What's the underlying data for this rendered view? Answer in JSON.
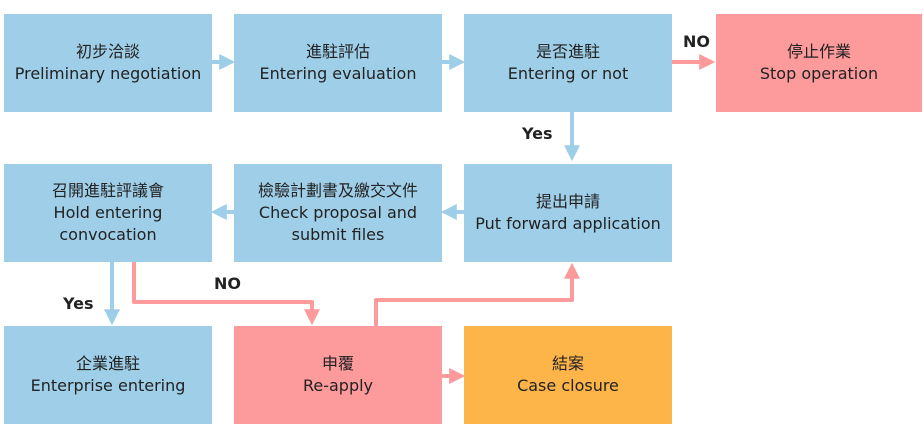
{
  "diagram": {
    "nodes": {
      "n1": {
        "zh": "初步洽談",
        "en": "Preliminary negotiation"
      },
      "n2": {
        "zh": "進駐評估",
        "en": "Entering evaluation"
      },
      "n3": {
        "zh": "是否進駐",
        "en": "Entering or not"
      },
      "n4": {
        "zh": "停止作業",
        "en": "Stop operation"
      },
      "n5": {
        "zh": "提出申請",
        "en": "Put forward application"
      },
      "n6": {
        "zh": "檢驗計劃書及繳交文件",
        "en": "Check proposal and\nsubmit files"
      },
      "n7": {
        "zh": "召開進駐評議會",
        "en": "Hold entering\nconvocation"
      },
      "n8": {
        "zh": "企業進駐",
        "en": "Enterprise entering"
      },
      "n9": {
        "zh": "申覆",
        "en": "Re-apply"
      },
      "n10": {
        "zh": "結案",
        "en": "Case closure"
      }
    },
    "edge_labels": {
      "no_top": "NO",
      "yes_mid": "Yes",
      "yes_left": "Yes",
      "no_bottom": "NO"
    },
    "colors": {
      "step": "#9fcfe8",
      "negative": "#fc9a9c",
      "closure": "#fdb54a",
      "arrow_positive": "#9fcfe8",
      "arrow_negative": "#fc9a9c"
    }
  }
}
